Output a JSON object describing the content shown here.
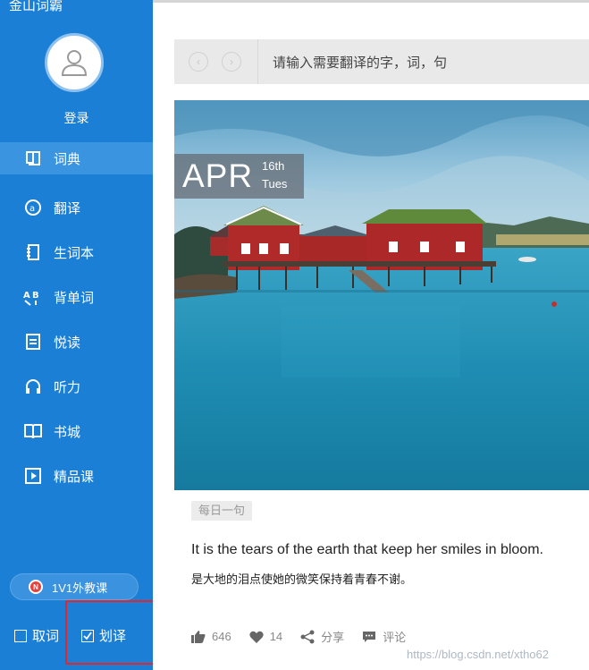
{
  "app": {
    "title": "金山词霸"
  },
  "user": {
    "login_label": "登录"
  },
  "sidebar": {
    "items": [
      {
        "label": "词典",
        "icon": "dictionary-icon",
        "active": true
      },
      {
        "label": "翻译",
        "icon": "translate-icon",
        "active": false
      },
      {
        "label": "生词本",
        "icon": "vocabulary-book-icon",
        "active": false
      },
      {
        "label": "背单词",
        "icon": "memorize-words-icon",
        "active": false
      },
      {
        "label": "悦读",
        "icon": "reading-icon",
        "active": false
      },
      {
        "label": "听力",
        "icon": "headphones-icon",
        "active": false
      },
      {
        "label": "书城",
        "icon": "bookstore-icon",
        "active": false
      },
      {
        "label": "精品课",
        "icon": "courses-icon",
        "active": false
      }
    ],
    "tutor_button": {
      "label": "1V1外教课",
      "badge": "N"
    },
    "options": {
      "quick_lookup": {
        "label": "取词",
        "checked": false
      },
      "quick_translate": {
        "label": "划译",
        "checked": true
      }
    },
    "color": "#1b7fd6"
  },
  "search": {
    "placeholder": "请输入需要翻译的字，词，句"
  },
  "daily": {
    "month": "APR",
    "day": "16th",
    "weekday": "Tues",
    "tag": "每日一句",
    "sentence_en": "It is the tears of the earth that keep her smiles in bloom.",
    "sentence_cn": "是大地的泪点使她的微笑保持着青春不谢。",
    "actions": {
      "thumbs_up": "646",
      "like": "14",
      "share": "分享",
      "comment": "评论"
    }
  },
  "watermark": "https://blog.csdn.net/xtho62"
}
